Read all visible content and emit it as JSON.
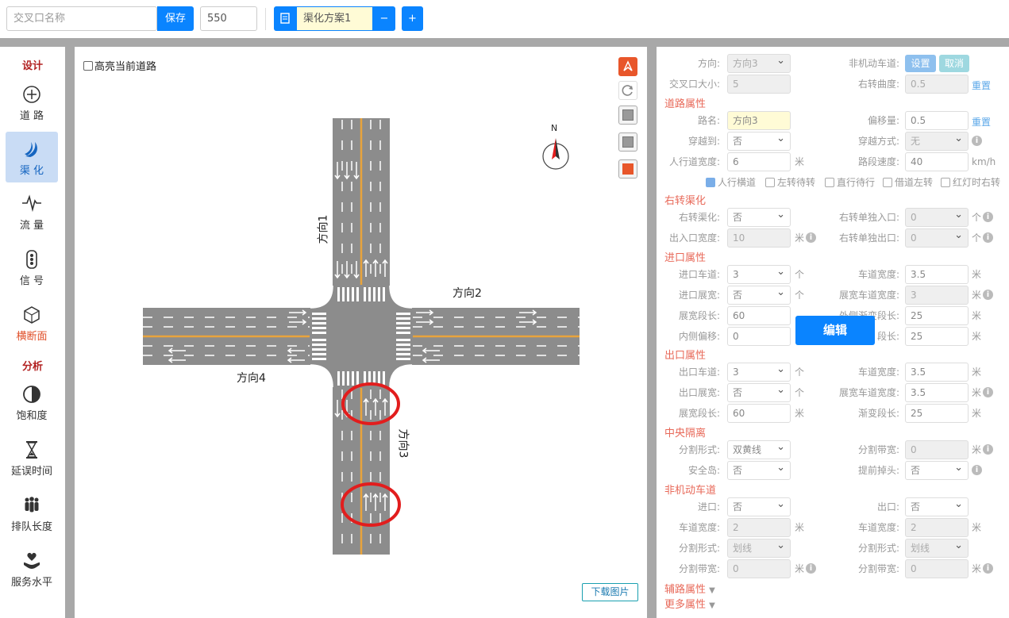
{
  "toolbar": {
    "name_placeholder": "交叉口名称",
    "save_label": "保存",
    "size_value": "550",
    "scheme_value": "渠化方案1",
    "minus_label": "−",
    "plus_label": "+"
  },
  "sidebar": {
    "section_design": "设计",
    "section_analysis": "分析",
    "items": [
      {
        "label": "道 路",
        "icon": "crosshair-icon"
      },
      {
        "label": "渠 化",
        "icon": "channel-icon"
      },
      {
        "label": "流 量",
        "icon": "pulse-icon"
      },
      {
        "label": "信 号",
        "icon": "traffic-light-icon"
      },
      {
        "label": "横断面",
        "icon": "cube-icon"
      },
      {
        "label": "饱和度",
        "icon": "half-circle-icon"
      },
      {
        "label": "延误时间",
        "icon": "hourglass-icon"
      },
      {
        "label": "排队长度",
        "icon": "people-icon"
      },
      {
        "label": "服务水平",
        "icon": "heart-hand-icon"
      }
    ]
  },
  "canvas": {
    "highlight_label": "高亮当前道路",
    "north_label": "N",
    "dir1": "方向1",
    "dir2": "方向2",
    "dir3": "方向3",
    "dir4": "方向4",
    "edit_label": "编辑",
    "download_label": "下载图片",
    "colors": {
      "road": "#8a8a8a",
      "median": "#e8a33c",
      "mark": "#ffffff",
      "circle": "#e21d1d",
      "accent": "#e8562a"
    }
  },
  "panel": {
    "direction_label": "方向:",
    "direction_value": "方向3",
    "nonmotor_label": "非机动车道:",
    "set_label": "设置",
    "cancel_label": "取消",
    "size_label": "交叉口大小:",
    "size_value": "5",
    "curve_label": "右转曲度:",
    "curve_value": "0.5",
    "reset_label": "重置",
    "road_header": "道路属性",
    "road_name_label": "路名:",
    "road_name_value": "方向3",
    "offset_label": "偏移量:",
    "offset_value": "0.5",
    "reset2_label": "重置",
    "cross_label": "穿越到:",
    "cross_value": "否",
    "cross_mode_label": "穿越方式:",
    "cross_mode_value": "无",
    "sidewalk_label": "人行道宽度:",
    "sidewalk_value": "6",
    "unit_m": "米",
    "speed_label": "路段速度:",
    "speed_value": "40",
    "unit_kmh": "km/h",
    "checks": [
      {
        "label": "人行横道",
        "on": true
      },
      {
        "label": "左转待转",
        "on": false
      },
      {
        "label": "直行待行",
        "on": false
      },
      {
        "label": "借道左转",
        "on": false
      },
      {
        "label": "红灯时右转",
        "on": false
      }
    ],
    "right_header": "右转渠化",
    "rt_chan_label": "右转渠化:",
    "rt_chan_value": "否",
    "rt_in_label": "右转单独入口:",
    "rt_in_value": "0",
    "unit_ge": "个",
    "io_width_label": "出入口宽度:",
    "io_width_value": "10",
    "rt_out_label": "右转单独出口:",
    "rt_out_value": "0",
    "entry_header": "进口属性",
    "en_lanes_label": "进口车道:",
    "en_lanes_value": "3",
    "en_lane_w_label": "车道宽度:",
    "en_lane_w_value": "3.5",
    "en_widen_label": "进口展宽:",
    "en_widen_value": "否",
    "en_widen_w_label": "展宽车道宽度:",
    "en_widen_w_value": "3",
    "en_widen_len_label": "展宽段长:",
    "en_widen_len_value": "60",
    "en_taper_label": "外侧渐变段长:",
    "en_taper_value": "25",
    "en_inner_label": "内侧偏移:",
    "en_inner_value": "0",
    "en_taper2_label": "段长:",
    "en_taper2_value": "25",
    "exit_header": "出口属性",
    "ex_lanes_label": "出口车道:",
    "ex_lanes_value": "3",
    "ex_lane_w_label": "车道宽度:",
    "ex_lane_w_value": "3.5",
    "ex_widen_label": "出口展宽:",
    "ex_widen_value": "否",
    "ex_widen_w_label": "展宽车道宽度:",
    "ex_widen_w_value": "3.5",
    "ex_widen_len_label": "展宽段长:",
    "ex_widen_len_value": "60",
    "ex_taper_label": "渐变段长:",
    "ex_taper_value": "25",
    "median_header": "中央隔离",
    "div_form_label": "分割形式:",
    "div_form_value": "双黄线",
    "div_width_label": "分割带宽:",
    "div_width_value": "0",
    "island_label": "安全岛:",
    "island_value": "否",
    "advance_label": "提前掉头:",
    "advance_value": "否",
    "bike_header": "非机动车道",
    "bk_in_label": "进口:",
    "bk_in_value": "否",
    "bk_out_label": "出口:",
    "bk_out_value": "否",
    "bk_w1_label": "车道宽度:",
    "bk_w1_value": "2",
    "bk_w2_label": "车道宽度:",
    "bk_w2_value": "2",
    "bk_f1_label": "分割形式:",
    "bk_f1_value": "划线",
    "bk_f2_label": "分割形式:",
    "bk_f2_value": "划线",
    "bk_d1_label": "分割带宽:",
    "bk_d1_value": "0",
    "bk_d2_label": "分割带宽:",
    "bk_d2_value": "0",
    "aux_header": "辅路属性",
    "more_header": "更多属性"
  }
}
